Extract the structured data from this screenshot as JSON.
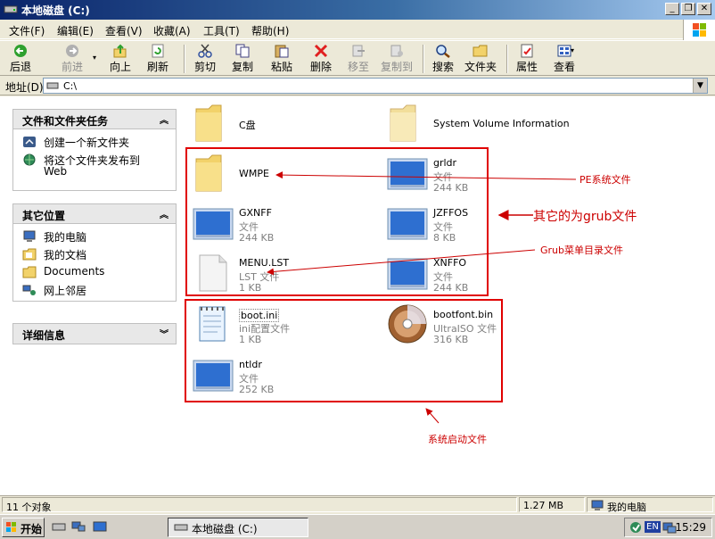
{
  "window": {
    "title": "本地磁盘 (C:)"
  },
  "menu": [
    "文件(F)",
    "编辑(E)",
    "查看(V)",
    "收藏(A)",
    "工具(T)",
    "帮助(H)"
  ],
  "toolbar": {
    "back": "后退",
    "forward": "前进",
    "up": "向上",
    "refresh": "刷新",
    "cut": "剪切",
    "copy": "复制",
    "paste": "粘贴",
    "delete": "删除",
    "move_to": "移至",
    "copy_to": "复制到",
    "search": "搜索",
    "folders": "文件夹",
    "properties": "属性",
    "views": "查看"
  },
  "address": {
    "label": "地址(D)",
    "value": "C:\\"
  },
  "panels": {
    "tasks": {
      "title": "文件和文件夹任务",
      "items": [
        "创建一个新文件夹",
        "将这个文件夹发布到",
        "Web"
      ]
    },
    "places": {
      "title": "其它位置",
      "items": [
        "我的电脑",
        "我的文档",
        "Documents",
        "网上邻居"
      ]
    },
    "details": {
      "title": "详细信息"
    }
  },
  "files": [
    {
      "name": "C盘",
      "type": "",
      "size": ""
    },
    {
      "name": "System Volume Information",
      "type": "",
      "size": ""
    },
    {
      "name": "WMPE",
      "type": "",
      "size": ""
    },
    {
      "name": "grldr",
      "type": "文件",
      "size": "244 KB"
    },
    {
      "name": "GXNFF",
      "type": "文件",
      "size": "244 KB"
    },
    {
      "name": "JZFFOS",
      "type": "文件",
      "size": "8 KB"
    },
    {
      "name": "MENU.LST",
      "type": "LST 文件",
      "size": "1 KB"
    },
    {
      "name": "XNFFO",
      "type": "文件",
      "size": "244 KB"
    },
    {
      "name": "boot.ini",
      "type": "ini配置文件",
      "size": "1 KB"
    },
    {
      "name": "bootfont.bin",
      "type": "UltraISO 文件",
      "size": "316 KB"
    },
    {
      "name": "ntldr",
      "type": "文件",
      "size": "252 KB"
    }
  ],
  "annotations": {
    "pe": "PE系统文件",
    "grub": "其它的为grub文件",
    "menu": "Grub菜单目录文件",
    "boot": "系统启动文件"
  },
  "status": {
    "count": "11 个对象",
    "size": "1.27 MB",
    "location": "我的电脑"
  },
  "taskbar": {
    "start": "开始",
    "task": "本地磁盘 (C:)",
    "lang": "EN",
    "clock": "15:29"
  },
  "colors": {
    "annotation": "#CC0000",
    "redbox": "#E00000",
    "titlebar": "#0A246A"
  }
}
